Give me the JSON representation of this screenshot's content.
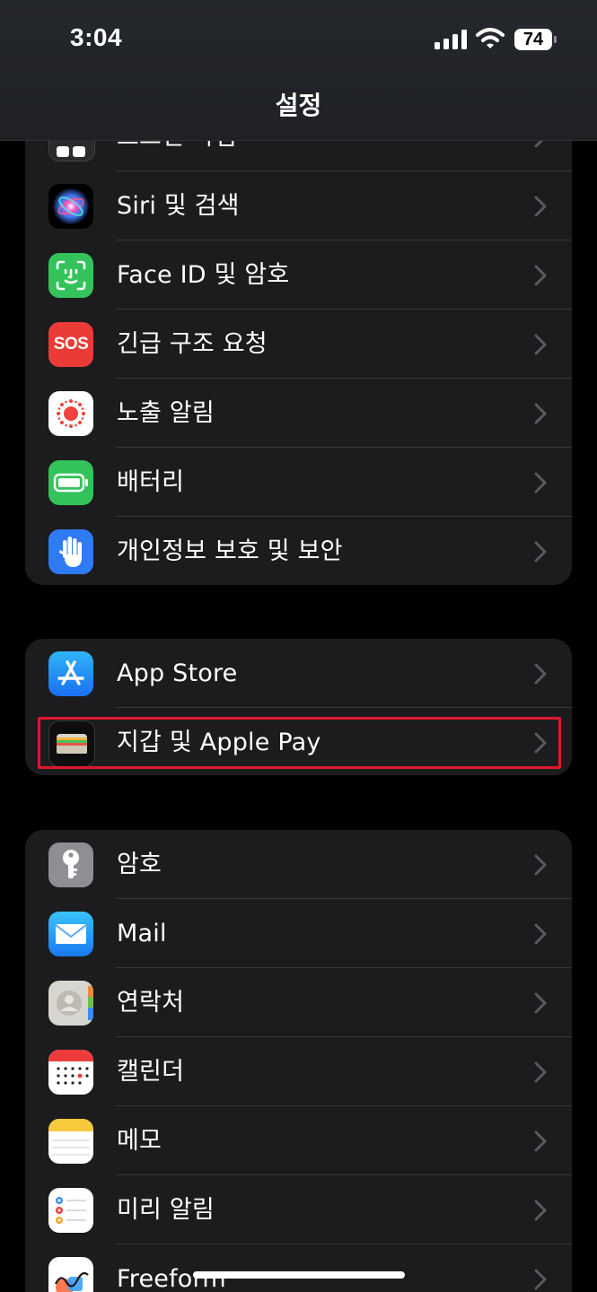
{
  "status_bar": {
    "time": "3:04",
    "battery": "74"
  },
  "nav": {
    "title": "설정"
  },
  "group1": [
    {
      "label": "스크린 타임",
      "icon": "screen-time-icon"
    },
    {
      "label": "Siri 및 검색",
      "icon": "siri-icon"
    },
    {
      "label": "Face ID 및 암호",
      "icon": "face-id-icon"
    },
    {
      "label": "긴급 구조 요청",
      "icon": "sos-icon"
    },
    {
      "label": "노출 알림",
      "icon": "exposure-notification-icon"
    },
    {
      "label": "배터리",
      "icon": "battery-icon"
    },
    {
      "label": "개인정보 보호 및 보안",
      "icon": "privacy-hand-icon"
    }
  ],
  "group2": [
    {
      "label": "App Store",
      "icon": "app-store-icon"
    },
    {
      "label": "지갑 및 Apple Pay",
      "icon": "wallet-icon"
    }
  ],
  "group3": [
    {
      "label": "암호",
      "icon": "key-icon"
    },
    {
      "label": "Mail",
      "icon": "mail-icon"
    },
    {
      "label": "연락처",
      "icon": "contacts-icon"
    },
    {
      "label": "캘린더",
      "icon": "calendar-icon"
    },
    {
      "label": "메모",
      "icon": "notes-icon"
    },
    {
      "label": "미리 알림",
      "icon": "reminders-icon"
    },
    {
      "label": "Freeform",
      "icon": "freeform-icon"
    }
  ],
  "icon_labels": {
    "sos": "SOS"
  },
  "colors": {
    "highlight": "#e0182d",
    "group_bg": "#1c1c1e",
    "separator": "#38383a"
  }
}
